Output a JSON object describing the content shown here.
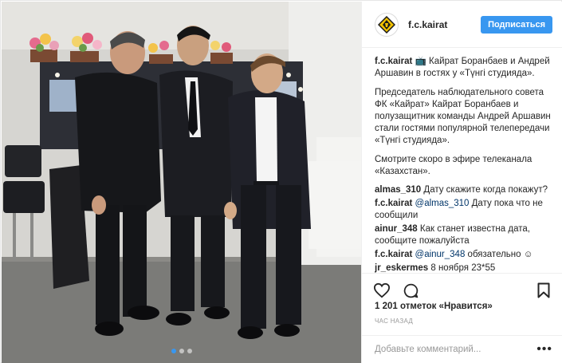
{
  "post": {
    "username": "f.c.kairat",
    "follow_label": "Подписаться",
    "carousel": {
      "count": 3,
      "active": 0
    }
  },
  "caption": {
    "username": "f.c.kairat",
    "emoji": "📺",
    "line1": "Кайрат Боранбаев и Андрей Аршавин в гостях у «Түнгі студияда».",
    "para2": "Председатель наблюдательного совета ФК «Кайрат» Кайрат Боранбаев и полузащитник команды Андрей Аршавин стали гостями популярной телепередачи «Түнгі студияда».",
    "para3": "Смотрите скоро в эфире телеканала «Казахстан»."
  },
  "comments": [
    {
      "user": "almas_310",
      "mention": "",
      "text": "Дату скажите когда покажут?"
    },
    {
      "user": "f.c.kairat",
      "mention": "@almas_310",
      "text": " Дату пока что не сообщили"
    },
    {
      "user": "ainur_348",
      "mention": "",
      "text": "Как станет известна дата, сообщите пожалуйста"
    },
    {
      "user": "f.c.kairat",
      "mention": "@ainur_348",
      "text": " обязательно ☺"
    },
    {
      "user": "jr_eskermes",
      "mention": "",
      "text": "8 ноября 23*55"
    }
  ],
  "likes": {
    "count": "1 201",
    "label": "отметок «Нравится»"
  },
  "time_ago": "ЧАС НАЗАД",
  "add_comment": {
    "placeholder": "Добавьте комментарий..."
  },
  "more_label": "•••",
  "colors": {
    "accent": "#3897f0",
    "link": "#003569",
    "text": "#262626",
    "muted": "#999999"
  },
  "icons": [
    "heart-icon",
    "comment-icon",
    "bookmark-icon",
    "kairat-logo-icon",
    "more-icon"
  ]
}
